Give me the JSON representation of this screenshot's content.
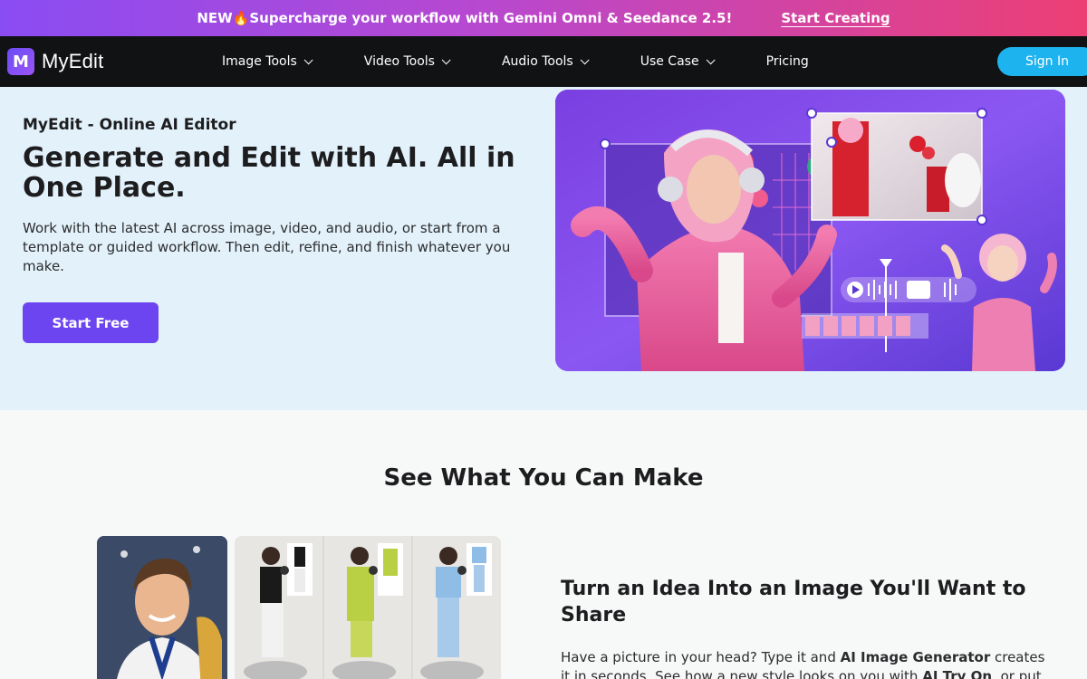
{
  "promo": {
    "text": "NEW🔥Supercharge your workflow with Gemini Omni & Seedance 2.5!",
    "cta": "Start Creating"
  },
  "nav": {
    "logo_letter": "M",
    "logo_text": "MyEdit",
    "items": [
      {
        "label": "Image Tools",
        "has_dropdown": true
      },
      {
        "label": "Video Tools",
        "has_dropdown": true
      },
      {
        "label": "Audio Tools",
        "has_dropdown": true
      },
      {
        "label": "Use Case",
        "has_dropdown": true
      },
      {
        "label": "Pricing",
        "has_dropdown": false
      }
    ],
    "signin": "Sign In"
  },
  "hero": {
    "kicker": "MyEdit - Online AI Editor",
    "title": "Generate and Edit with AI. All in One Place.",
    "description": "Work with the latest AI across image, video, and audio, or start from a template or guided workflow. Then edit, refine, and finish whatever you make.",
    "cta": "Start Free"
  },
  "section": {
    "title": "See What You Can Make"
  },
  "feature": {
    "title": "Turn an Idea Into an Image You'll Want to Share",
    "desc_prefix": "Have a picture in your head? Type it and ",
    "desc_bold1": "AI Image Generator",
    "desc_mid": " creates it in seconds. See how a new style looks on you with ",
    "desc_bold2": "AI Try On",
    "desc_suffix": ", or put"
  },
  "colors": {
    "accent": "#6d45f0",
    "signin": "#1db3ee",
    "nav_bg": "#111214",
    "hero_bg": "#e2f1fa"
  }
}
